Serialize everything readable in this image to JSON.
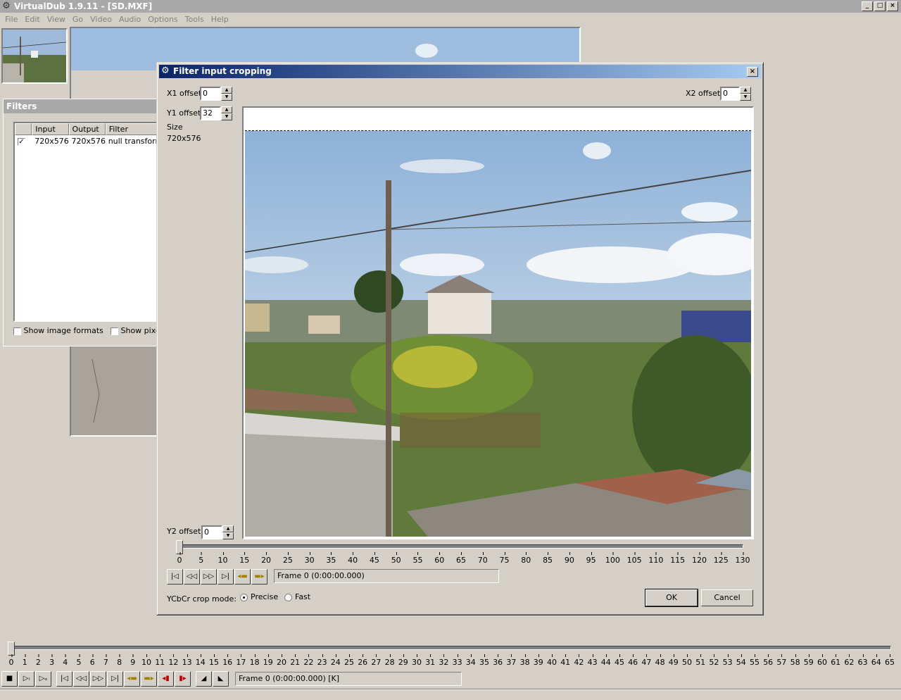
{
  "app": {
    "title": "VirtualDub 1.9.11 - [SD.MXF]",
    "window_buttons": [
      "_",
      "□",
      "×"
    ]
  },
  "menu": [
    "File",
    "Edit",
    "View",
    "Go",
    "Video",
    "Audio",
    "Options",
    "Tools",
    "Help"
  ],
  "filters_window": {
    "title": "Filters",
    "columns": [
      "Input",
      "Output",
      "Filter"
    ],
    "rows": [
      {
        "checked": true,
        "input": "720x576",
        "output": "720x576",
        "filter": "null transform"
      }
    ],
    "show_image_formats": "Show image formats",
    "show_pixel": "Show pixe"
  },
  "dialog": {
    "title": "Filter input cropping",
    "close": "×",
    "x1_label": "X1 offset",
    "x1_value": "0",
    "y1_label": "Y1 offset",
    "y1_value": "32",
    "x2_label": "X2 offset",
    "x2_value": "0",
    "y2_label": "Y2 offset",
    "y2_value": "0",
    "size_label": "Size",
    "size_value": "720x576",
    "frame_text": "Frame 0 (0:00:00.000)",
    "timeline_ticks": [
      "0",
      "5",
      "10",
      "15",
      "20",
      "25",
      "30",
      "35",
      "40",
      "45",
      "50",
      "55",
      "60",
      "65",
      "70",
      "75",
      "80",
      "85",
      "90",
      "95",
      "100",
      "105",
      "110",
      "115",
      "120",
      "125",
      "130"
    ],
    "crop_mode_label": "YCbCr crop mode:",
    "precise": "Precise",
    "fast": "Fast",
    "ok": "OK",
    "cancel": "Cancel"
  },
  "main_timeline": {
    "ticks": [
      "0",
      "1",
      "2",
      "3",
      "4",
      "5",
      "6",
      "7",
      "8",
      "9",
      "10",
      "11",
      "12",
      "13",
      "14",
      "15",
      "16",
      "17",
      "18",
      "19",
      "20",
      "21",
      "22",
      "23",
      "24",
      "25",
      "26",
      "27",
      "28",
      "29",
      "30",
      "31",
      "32",
      "33",
      "34",
      "35",
      "36",
      "37",
      "38",
      "39",
      "40",
      "41",
      "42",
      "43",
      "44",
      "45",
      "46",
      "47",
      "48",
      "49",
      "50",
      "51",
      "52",
      "53",
      "54",
      "55",
      "56",
      "57",
      "58",
      "59",
      "60",
      "61",
      "62",
      "63",
      "64",
      "65"
    ],
    "frame_text": "Frame 0 (0:00:00.000) [K]"
  },
  "colors": {
    "dialog_title_start": "#0a246a",
    "dialog_title_end": "#a6caf0",
    "inactive_title": "#a9a9a9",
    "face": "#d4d0c8"
  }
}
